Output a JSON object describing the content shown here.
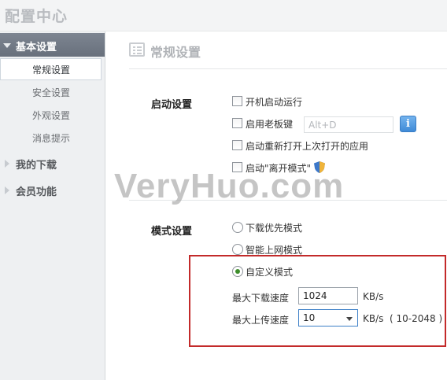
{
  "app": {
    "title": "配置中心"
  },
  "sidebar": {
    "sections": [
      {
        "label": "基本设置",
        "expanded": true
      },
      {
        "label": "我的下载",
        "expanded": false
      },
      {
        "label": "会员功能",
        "expanded": false
      }
    ],
    "items": [
      {
        "label": "常规设置",
        "selected": true
      },
      {
        "label": "安全设置"
      },
      {
        "label": "外观设置"
      },
      {
        "label": "消息提示"
      }
    ]
  },
  "main": {
    "title": "常规设置",
    "startup": {
      "label": "启动设置",
      "options": [
        {
          "label": "开机启动运行",
          "checked": false
        },
        {
          "label": "启用老板键",
          "checked": false
        },
        {
          "label": "启动重新打开上次打开的应用",
          "checked": false
        },
        {
          "label": "启动\"离开模式\"",
          "checked": false
        }
      ],
      "boss_key_placeholder": "Alt+D",
      "info_button": "i"
    },
    "mode": {
      "label": "模式设置",
      "options": [
        {
          "label": "下载优先模式",
          "checked": false
        },
        {
          "label": "智能上网模式",
          "checked": false
        },
        {
          "label": "自定义模式",
          "checked": true
        }
      ],
      "max_download_label": "最大下载速度",
      "max_download_value": "1024",
      "max_download_unit": "KB/s",
      "max_upload_label": "最大上传速度",
      "max_upload_value": "10",
      "max_upload_unit": "KB/s",
      "max_upload_range": "( 10-2048 )"
    }
  },
  "watermark": "VeryHuo.com",
  "colors": {
    "highlight_border": "#c32a2a",
    "sidebar_active": "#6f7783",
    "radio_checked": "#3e8e2c"
  }
}
